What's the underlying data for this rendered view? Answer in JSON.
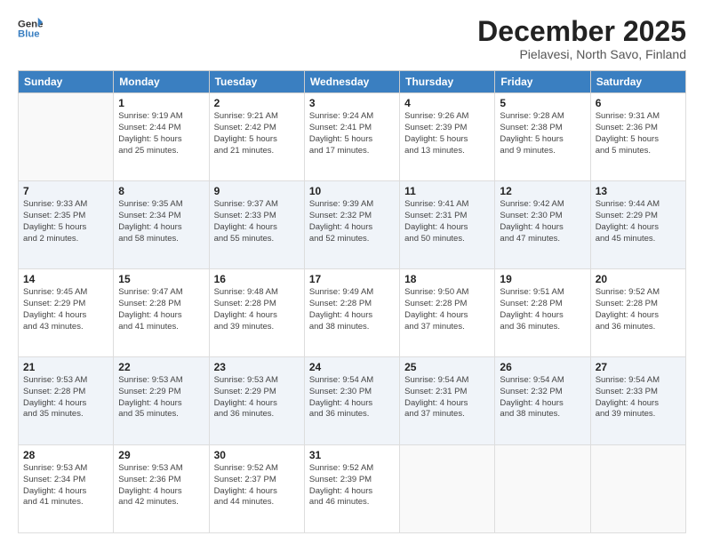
{
  "logo": {
    "text_general": "General",
    "text_blue": "Blue"
  },
  "title": "December 2025",
  "subtitle": "Pielavesi, North Savo, Finland",
  "weekdays": [
    "Sunday",
    "Monday",
    "Tuesday",
    "Wednesday",
    "Thursday",
    "Friday",
    "Saturday"
  ],
  "weeks": [
    [
      {
        "day": "",
        "info": ""
      },
      {
        "day": "1",
        "info": "Sunrise: 9:19 AM\nSunset: 2:44 PM\nDaylight: 5 hours\nand 25 minutes."
      },
      {
        "day": "2",
        "info": "Sunrise: 9:21 AM\nSunset: 2:42 PM\nDaylight: 5 hours\nand 21 minutes."
      },
      {
        "day": "3",
        "info": "Sunrise: 9:24 AM\nSunset: 2:41 PM\nDaylight: 5 hours\nand 17 minutes."
      },
      {
        "day": "4",
        "info": "Sunrise: 9:26 AM\nSunset: 2:39 PM\nDaylight: 5 hours\nand 13 minutes."
      },
      {
        "day": "5",
        "info": "Sunrise: 9:28 AM\nSunset: 2:38 PM\nDaylight: 5 hours\nand 9 minutes."
      },
      {
        "day": "6",
        "info": "Sunrise: 9:31 AM\nSunset: 2:36 PM\nDaylight: 5 hours\nand 5 minutes."
      }
    ],
    [
      {
        "day": "7",
        "info": "Sunrise: 9:33 AM\nSunset: 2:35 PM\nDaylight: 5 hours\nand 2 minutes."
      },
      {
        "day": "8",
        "info": "Sunrise: 9:35 AM\nSunset: 2:34 PM\nDaylight: 4 hours\nand 58 minutes."
      },
      {
        "day": "9",
        "info": "Sunrise: 9:37 AM\nSunset: 2:33 PM\nDaylight: 4 hours\nand 55 minutes."
      },
      {
        "day": "10",
        "info": "Sunrise: 9:39 AM\nSunset: 2:32 PM\nDaylight: 4 hours\nand 52 minutes."
      },
      {
        "day": "11",
        "info": "Sunrise: 9:41 AM\nSunset: 2:31 PM\nDaylight: 4 hours\nand 50 minutes."
      },
      {
        "day": "12",
        "info": "Sunrise: 9:42 AM\nSunset: 2:30 PM\nDaylight: 4 hours\nand 47 minutes."
      },
      {
        "day": "13",
        "info": "Sunrise: 9:44 AM\nSunset: 2:29 PM\nDaylight: 4 hours\nand 45 minutes."
      }
    ],
    [
      {
        "day": "14",
        "info": "Sunrise: 9:45 AM\nSunset: 2:29 PM\nDaylight: 4 hours\nand 43 minutes."
      },
      {
        "day": "15",
        "info": "Sunrise: 9:47 AM\nSunset: 2:28 PM\nDaylight: 4 hours\nand 41 minutes."
      },
      {
        "day": "16",
        "info": "Sunrise: 9:48 AM\nSunset: 2:28 PM\nDaylight: 4 hours\nand 39 minutes."
      },
      {
        "day": "17",
        "info": "Sunrise: 9:49 AM\nSunset: 2:28 PM\nDaylight: 4 hours\nand 38 minutes."
      },
      {
        "day": "18",
        "info": "Sunrise: 9:50 AM\nSunset: 2:28 PM\nDaylight: 4 hours\nand 37 minutes."
      },
      {
        "day": "19",
        "info": "Sunrise: 9:51 AM\nSunset: 2:28 PM\nDaylight: 4 hours\nand 36 minutes."
      },
      {
        "day": "20",
        "info": "Sunrise: 9:52 AM\nSunset: 2:28 PM\nDaylight: 4 hours\nand 36 minutes."
      }
    ],
    [
      {
        "day": "21",
        "info": "Sunrise: 9:53 AM\nSunset: 2:28 PM\nDaylight: 4 hours\nand 35 minutes."
      },
      {
        "day": "22",
        "info": "Sunrise: 9:53 AM\nSunset: 2:29 PM\nDaylight: 4 hours\nand 35 minutes."
      },
      {
        "day": "23",
        "info": "Sunrise: 9:53 AM\nSunset: 2:29 PM\nDaylight: 4 hours\nand 36 minutes."
      },
      {
        "day": "24",
        "info": "Sunrise: 9:54 AM\nSunset: 2:30 PM\nDaylight: 4 hours\nand 36 minutes."
      },
      {
        "day": "25",
        "info": "Sunrise: 9:54 AM\nSunset: 2:31 PM\nDaylight: 4 hours\nand 37 minutes."
      },
      {
        "day": "26",
        "info": "Sunrise: 9:54 AM\nSunset: 2:32 PM\nDaylight: 4 hours\nand 38 minutes."
      },
      {
        "day": "27",
        "info": "Sunrise: 9:54 AM\nSunset: 2:33 PM\nDaylight: 4 hours\nand 39 minutes."
      }
    ],
    [
      {
        "day": "28",
        "info": "Sunrise: 9:53 AM\nSunset: 2:34 PM\nDaylight: 4 hours\nand 41 minutes."
      },
      {
        "day": "29",
        "info": "Sunrise: 9:53 AM\nSunset: 2:36 PM\nDaylight: 4 hours\nand 42 minutes."
      },
      {
        "day": "30",
        "info": "Sunrise: 9:52 AM\nSunset: 2:37 PM\nDaylight: 4 hours\nand 44 minutes."
      },
      {
        "day": "31",
        "info": "Sunrise: 9:52 AM\nSunset: 2:39 PM\nDaylight: 4 hours\nand 46 minutes."
      },
      {
        "day": "",
        "info": ""
      },
      {
        "day": "",
        "info": ""
      },
      {
        "day": "",
        "info": ""
      }
    ]
  ]
}
